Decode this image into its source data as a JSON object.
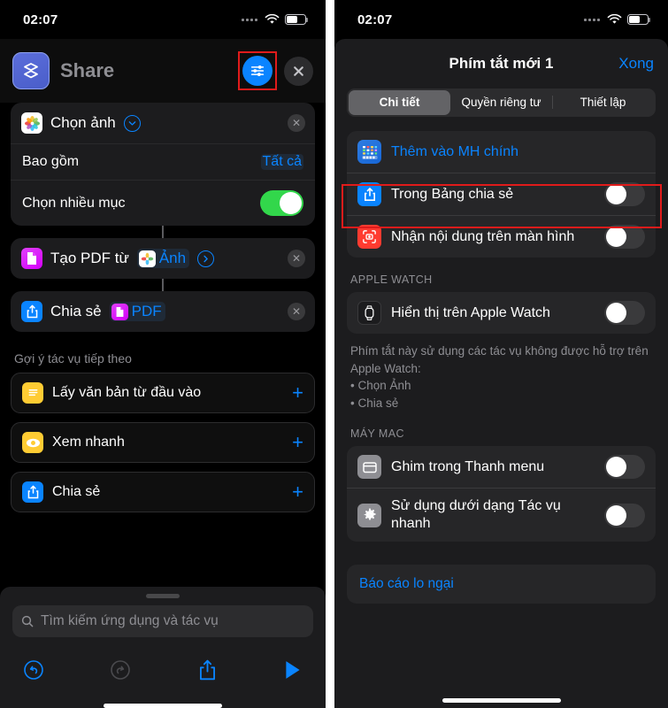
{
  "statusbar": {
    "time": "02:07",
    "signal_icon": "signal-dots-icon",
    "wifi_icon": "wifi-icon",
    "battery_icon": "battery-icon"
  },
  "left": {
    "header": {
      "app_icon": "shortcuts-app-icon",
      "title": "Share",
      "settings_button_icon": "sliders-icon",
      "close_button_icon": "close-x-icon"
    },
    "actions": [
      {
        "icon": "photos-app-icon",
        "title": "Chọn ảnh",
        "expand_icon": "chevron-down-circle-icon",
        "remove_icon": "remove-x-icon",
        "params": [
          {
            "label": "Bao gồm",
            "value": "Tất cả",
            "type": "value"
          },
          {
            "label": "Chọn nhiều mục",
            "value": "on",
            "type": "toggle"
          }
        ]
      },
      {
        "icon": "pdf-app-icon",
        "title": "Tạo PDF từ",
        "token": {
          "icon": "photos-app-icon",
          "label": "Ảnh"
        },
        "expand_icon": "chevron-right-circle-icon",
        "remove_icon": "remove-x-icon",
        "params": []
      },
      {
        "icon": "share-app-icon",
        "title": "Chia sẻ",
        "token": {
          "icon": "pdf-app-icon",
          "label": "PDF"
        },
        "remove_icon": "remove-x-icon",
        "params": []
      }
    ],
    "suggestions": {
      "title": "Gợi ý tác vụ tiếp theo",
      "items": [
        {
          "icon": "text-doc-icon",
          "label": "Lấy văn bản từ đầu vào",
          "add_icon": "plus-icon"
        },
        {
          "icon": "quicklook-eye-icon",
          "label": "Xem nhanh",
          "add_icon": "plus-icon"
        },
        {
          "icon": "share-app-icon",
          "label": "Chia sẻ",
          "add_icon": "plus-icon"
        }
      ]
    },
    "search": {
      "placeholder": "Tìm kiếm ứng dụng và tác vụ",
      "icon": "search-icon"
    },
    "toolbar": [
      {
        "name": "undo-button",
        "icon": "undo-icon",
        "state": "enabled"
      },
      {
        "name": "redo-button",
        "icon": "redo-icon",
        "state": "disabled"
      },
      {
        "name": "share-button",
        "icon": "share-up-icon",
        "state": "enabled"
      },
      {
        "name": "run-button",
        "icon": "play-icon",
        "state": "enabled"
      }
    ]
  },
  "right": {
    "header": {
      "title": "Phím tắt mới 1",
      "done_label": "Xong"
    },
    "segments": [
      {
        "label": "Chi tiết",
        "active": true
      },
      {
        "label": "Quyền riêng tư",
        "active": false
      },
      {
        "label": "Thiết lập",
        "active": false
      }
    ],
    "main_group": [
      {
        "icon": "home-screen-icon",
        "label": "Thêm vào MH chính",
        "type": "link",
        "highlighted": true
      },
      {
        "icon": "share-sheet-icon",
        "label": "Trong Bảng chia sẻ",
        "type": "toggle",
        "value": "off"
      },
      {
        "icon": "screen-capture-icon",
        "label": "Nhận nội dung trên màn hình",
        "type": "toggle",
        "value": "off"
      }
    ],
    "watch_section": {
      "header": "APPLE WATCH",
      "rows": [
        {
          "icon": "apple-watch-icon",
          "label": "Hiển thị trên Apple Watch",
          "type": "toggle",
          "value": "off"
        }
      ],
      "note": "Phím tắt này sử dụng các tác vụ không được hỗ trợ trên Apple Watch:",
      "note_bullets": [
        "• Chọn Ảnh",
        "• Chia sẻ"
      ]
    },
    "mac_section": {
      "header": "MÁY MAC",
      "rows": [
        {
          "icon": "menubar-icon",
          "label": "Ghim trong Thanh menu",
          "type": "toggle",
          "value": "off"
        },
        {
          "icon": "gear-icon",
          "label": "Sử dụng dưới dạng Tác vụ nhanh",
          "type": "toggle",
          "value": "off"
        }
      ]
    },
    "footer": {
      "label": "Báo cáo lo ngại"
    }
  },
  "colors": {
    "accent_blue": "#0a84ff",
    "toggle_on_green": "#32d74b",
    "highlight_red": "#e01b1b",
    "card_bg": "#1c1c1e"
  }
}
